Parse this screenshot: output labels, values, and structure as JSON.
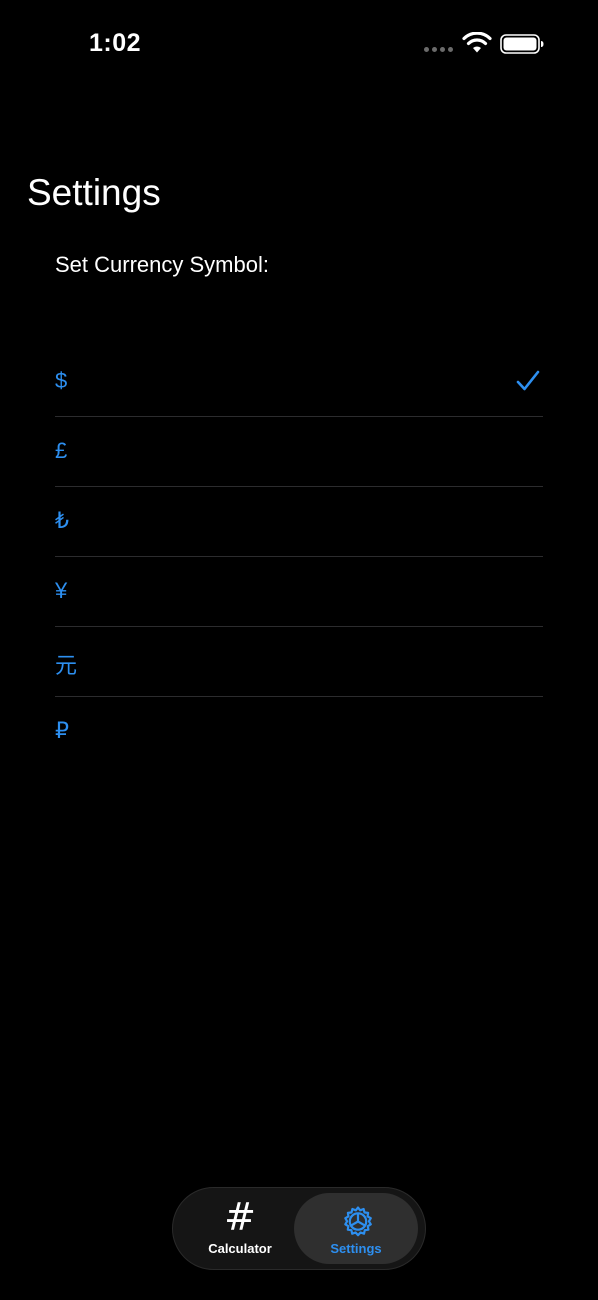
{
  "status_bar": {
    "time": "1:02"
  },
  "header": {
    "title": "Settings"
  },
  "section": {
    "label": "Set Currency Symbol:"
  },
  "currencies": [
    {
      "symbol": "$",
      "selected": true
    },
    {
      "symbol": "£",
      "selected": false
    },
    {
      "symbol": "₺",
      "selected": false
    },
    {
      "symbol": "¥",
      "selected": false
    },
    {
      "symbol": "元",
      "selected": false
    },
    {
      "symbol": "₽",
      "selected": false
    }
  ],
  "tab_bar": {
    "tabs": [
      {
        "label": "Calculator",
        "icon": "hash-icon",
        "active": false
      },
      {
        "label": "Settings",
        "icon": "gear-icon",
        "active": true
      }
    ]
  },
  "colors": {
    "accent": "#2d8ff0",
    "background": "#000000",
    "separator": "#2c2c2e"
  }
}
